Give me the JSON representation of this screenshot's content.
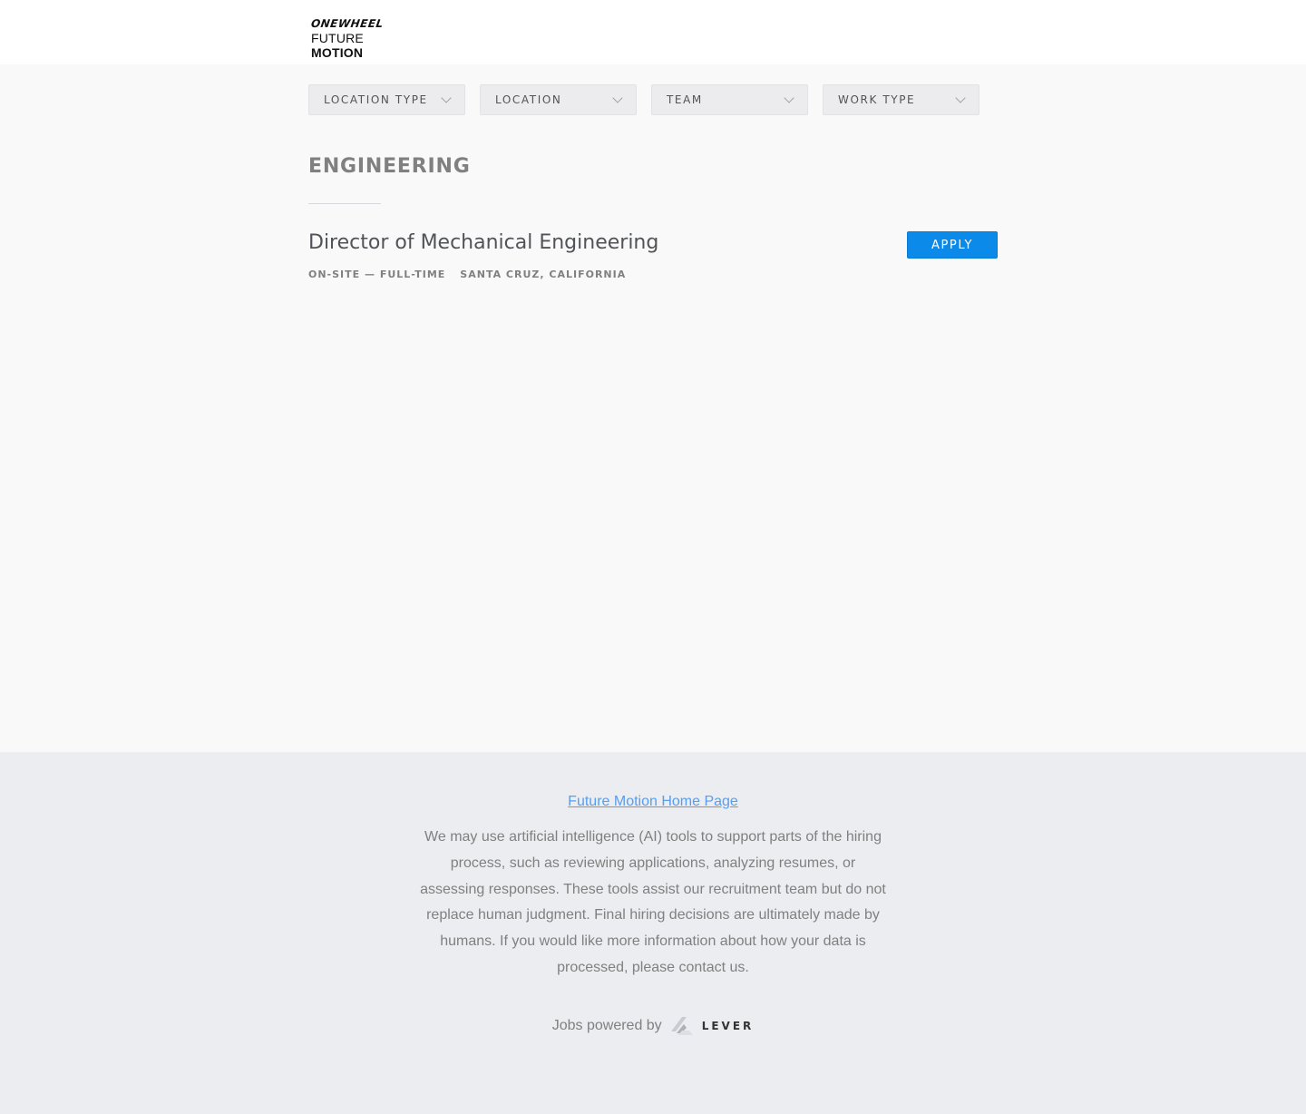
{
  "header": {
    "logo_line1": "ONEWHEEL",
    "logo_line2_regular": "FUTURE",
    "logo_line2_bold": "MOTION"
  },
  "filters": [
    {
      "label": "LOCATION TYPE",
      "icon": "chevron-down-icon"
    },
    {
      "label": "LOCATION",
      "icon": "chevron-down-icon"
    },
    {
      "label": "TEAM",
      "icon": "chevron-down-icon"
    },
    {
      "label": "WORK TYPE",
      "icon": "chevron-down-icon"
    }
  ],
  "team": {
    "title": "ENGINEERING"
  },
  "postings": [
    {
      "title": "Director of Mechanical Engineering",
      "commitment": "ON-SITE — FULL-TIME",
      "location": "SANTA CRUZ, CALIFORNIA",
      "apply_label": "APPLY"
    }
  ],
  "footer": {
    "home_link": "Future Motion Home Page",
    "ai_notice": "We may use artificial intelligence (AI) tools to support parts of the hiring process, such as reviewing applications, analyzing resumes, or assessing responses. These tools assist our recruitment team but do not replace human judgment. Final hiring decisions are ultimately made by humans. If you would like more information about how your data is processed, please contact us.",
    "powered_by": "Jobs powered by",
    "lever_wordmark": "LEVER"
  },
  "colors": {
    "accent": "#0c8ae9",
    "link": "#579eee",
    "footer_bg": "#ebedf0",
    "page_bg": "#f9f9fa"
  }
}
